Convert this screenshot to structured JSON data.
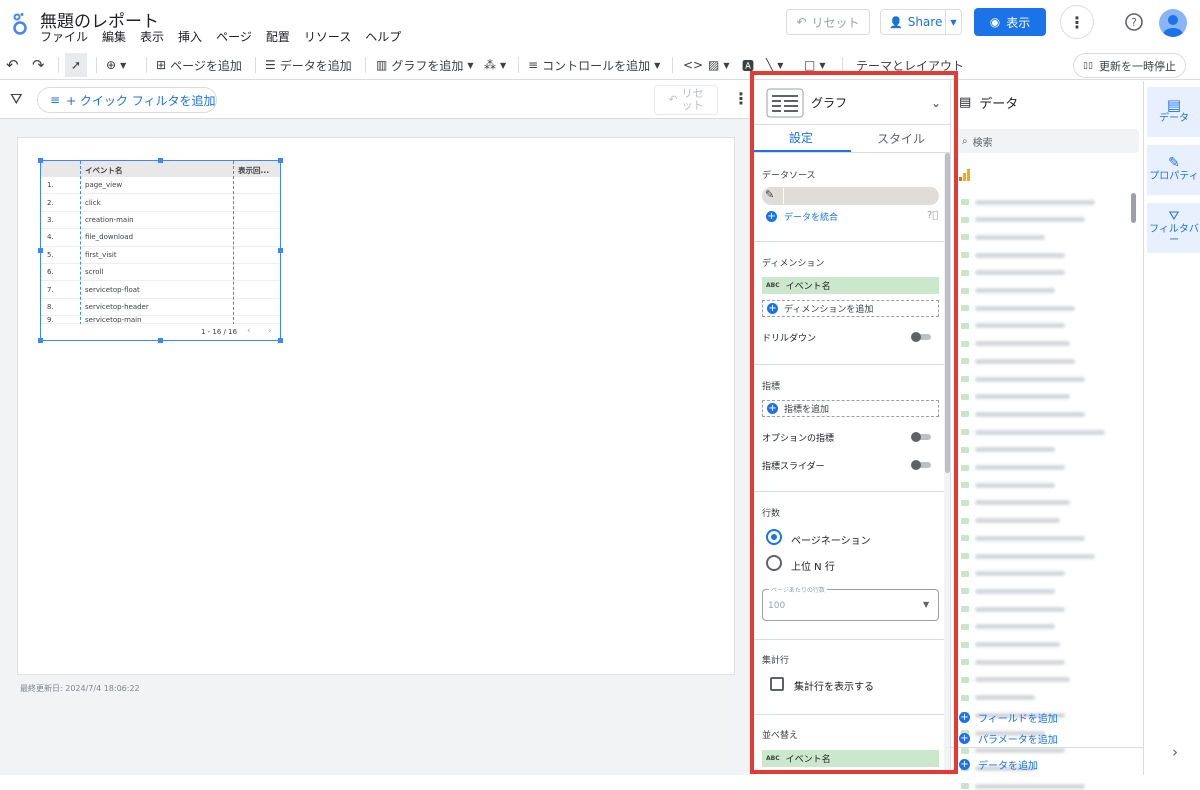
{
  "header": {
    "title": "無題のレポート",
    "menu": [
      "ファイル",
      "編集",
      "表示",
      "挿入",
      "ページ",
      "配置",
      "リソース",
      "ヘルプ"
    ],
    "reset_label": "リセット",
    "share_label": "Share",
    "view_label": "表示"
  },
  "toolbar": {
    "add_page": "ページを追加",
    "add_data": "データを追加",
    "add_chart": "グラフを追加",
    "add_control": "コントロールを追加",
    "theme_layout": "テーマとレイアウト",
    "pause_update": "更新を一時停止"
  },
  "filterbar": {
    "quick_filter": "+ クイック フィルタを追加",
    "reset_line1": "リセ",
    "reset_line2": "ット"
  },
  "canvas": {
    "last_updated": "最終更新日: 2024/7/4 18:06:22",
    "table": {
      "col_event": "イベント名",
      "col_views": "表示回...",
      "rows": [
        {
          "num": "1.",
          "event": "page_view"
        },
        {
          "num": "2.",
          "event": "click"
        },
        {
          "num": "3.",
          "event": "creation-main"
        },
        {
          "num": "4.",
          "event": "file_download"
        },
        {
          "num": "5.",
          "event": "first_visit"
        },
        {
          "num": "6.",
          "event": "scroll"
        },
        {
          "num": "7.",
          "event": "servicetop-float"
        },
        {
          "num": "8.",
          "event": "servicetop-header"
        },
        {
          "num": "9.",
          "event": "servicetop-main"
        }
      ],
      "pagination": "1 - 16 / 16"
    }
  },
  "graph_panel": {
    "chart_type": "グラフ",
    "tab_settings": "設定",
    "tab_style": "スタイル",
    "data_source_title": "データソース",
    "blend_data": "データを統合",
    "dimension_title": "ディメンション",
    "dimension_chip": "イベント名",
    "chip_type": "ABC",
    "add_dimension": "ディメンションを追加",
    "drilldown": "ドリルダウン",
    "metric_title": "指標",
    "add_metric": "指標を追加",
    "optional_metric": "オプションの指標",
    "metric_slider": "指標スライダー",
    "rows_title": "行数",
    "pagination": "ページネーション",
    "top_n": "上位 N 行",
    "rows_per_page_label": "ページあたりの行数",
    "rows_per_page_value": "100",
    "summary_title": "集計行",
    "show_summary": "集計行を表示する",
    "sort_title": "並べ替え",
    "sort_chip": "イベント名"
  },
  "data_panel": {
    "title": "データ",
    "search_placeholder": "検索",
    "add_field": "フィールドを追加",
    "add_parameter": "パラメータを追加",
    "add_data": "データを追加"
  },
  "rail": {
    "data": "データ",
    "properties": "プロパティ",
    "filter_bar": "フィルタバー"
  },
  "colors": {
    "accent": "#1a73e8",
    "highlight_box": "#e53935",
    "chip_green": "#cce8cc"
  }
}
